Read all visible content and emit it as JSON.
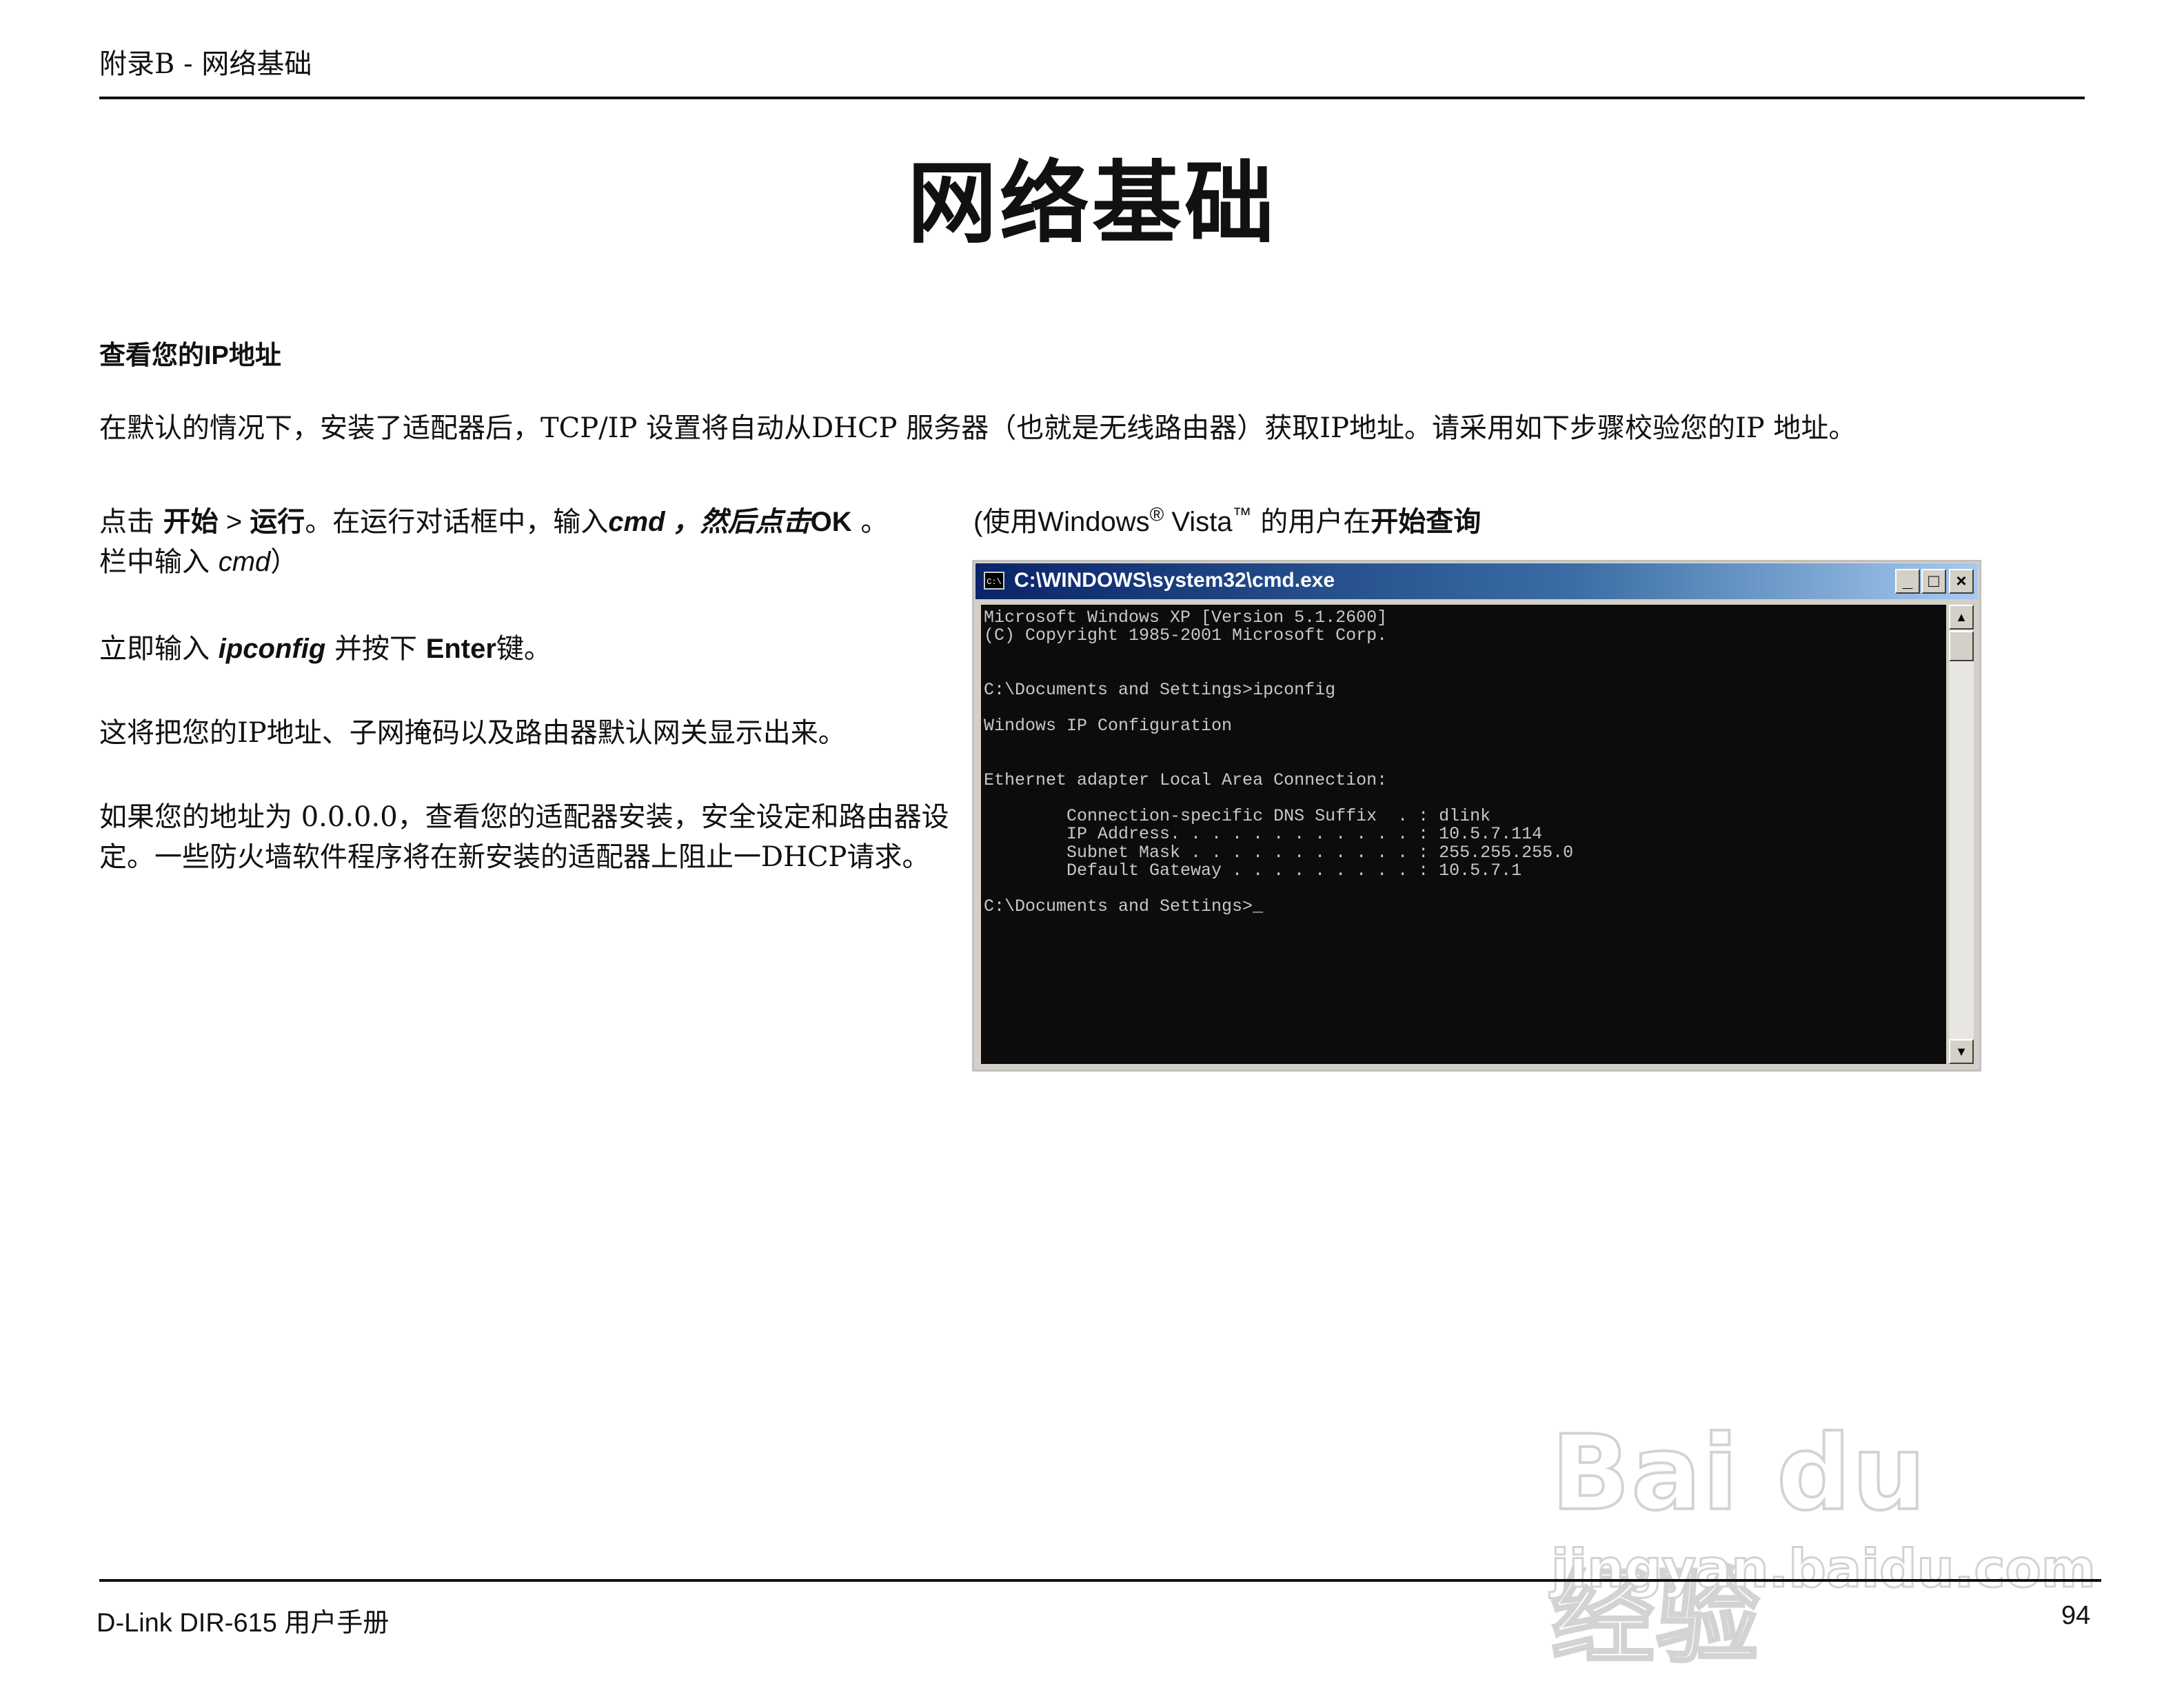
{
  "header": {
    "text": "附录B - 网络基础"
  },
  "page_title": "网络基础",
  "section": {
    "heading": "查看您的IP地址",
    "intro": "在默认的情况下，安装了适配器后，TCP/IP 设置将自动从DHCP 服务器（也就是无线路由器）获取IP地址。请采用如下步骤校验您的IP 地址。"
  },
  "step1": {
    "t1": "点击 ",
    "start": "开始",
    "t2": " > ",
    "run": "运行",
    "t3": "。在运行对话框中，输入",
    "cmd": "cmd ，然后点击",
    "ok": "OK",
    "t4": " 。 ",
    "t5": "(使用Windows",
    "reg": "®",
    "t6": " Vista",
    "tm": "™",
    "t7": " 的用户在",
    "start_search": "开始查询",
    "t8": "栏中输入 ",
    "cmd2": "cmd",
    "t9": "）"
  },
  "step2": {
    "t1": "立即输入 ",
    "ipconfig": "ipconfig",
    "t2": " 并按下 ",
    "enter": "Enter",
    "t3": "键。"
  },
  "step3": "这将把您的IP地址、子网掩码以及路由器默认网关显示出来。",
  "step4": "如果您的地址为 0.0.0.0，查看您的适配器安装，安全设定和路由器设定。一些防火墙软件程序将在新安装的适配器上阻止一DHCP请求。",
  "cmd_window": {
    "icon_label": "C:\\",
    "title": "C:\\WINDOWS\\system32\\cmd.exe",
    "btn_min": "_",
    "btn_max": "□",
    "btn_close": "×",
    "console": "Microsoft Windows XP [Version 5.1.2600]\n(C) Copyright 1985-2001 Microsoft Corp.\n\n\nC:\\Documents and Settings>ipconfig\n\nWindows IP Configuration\n\n\nEthernet adapter Local Area Connection:\n\n        Connection-specific DNS Suffix  . : dlink\n        IP Address. . . . . . . . . . . . : 10.5.7.114\n        Subnet Mask . . . . . . . . . . . : 255.255.255.0\n        Default Gateway . . . . . . . . . : 10.5.7.1\n\nC:\\Documents and Settings>_",
    "scroll_up": "▲",
    "scroll_down": "▼"
  },
  "watermark": {
    "line1": "Bai du 经验",
    "line2": "jingyan.baidu.com"
  },
  "footer": {
    "left": "D-Link DIR-615 用户手册",
    "page_number": "94"
  }
}
